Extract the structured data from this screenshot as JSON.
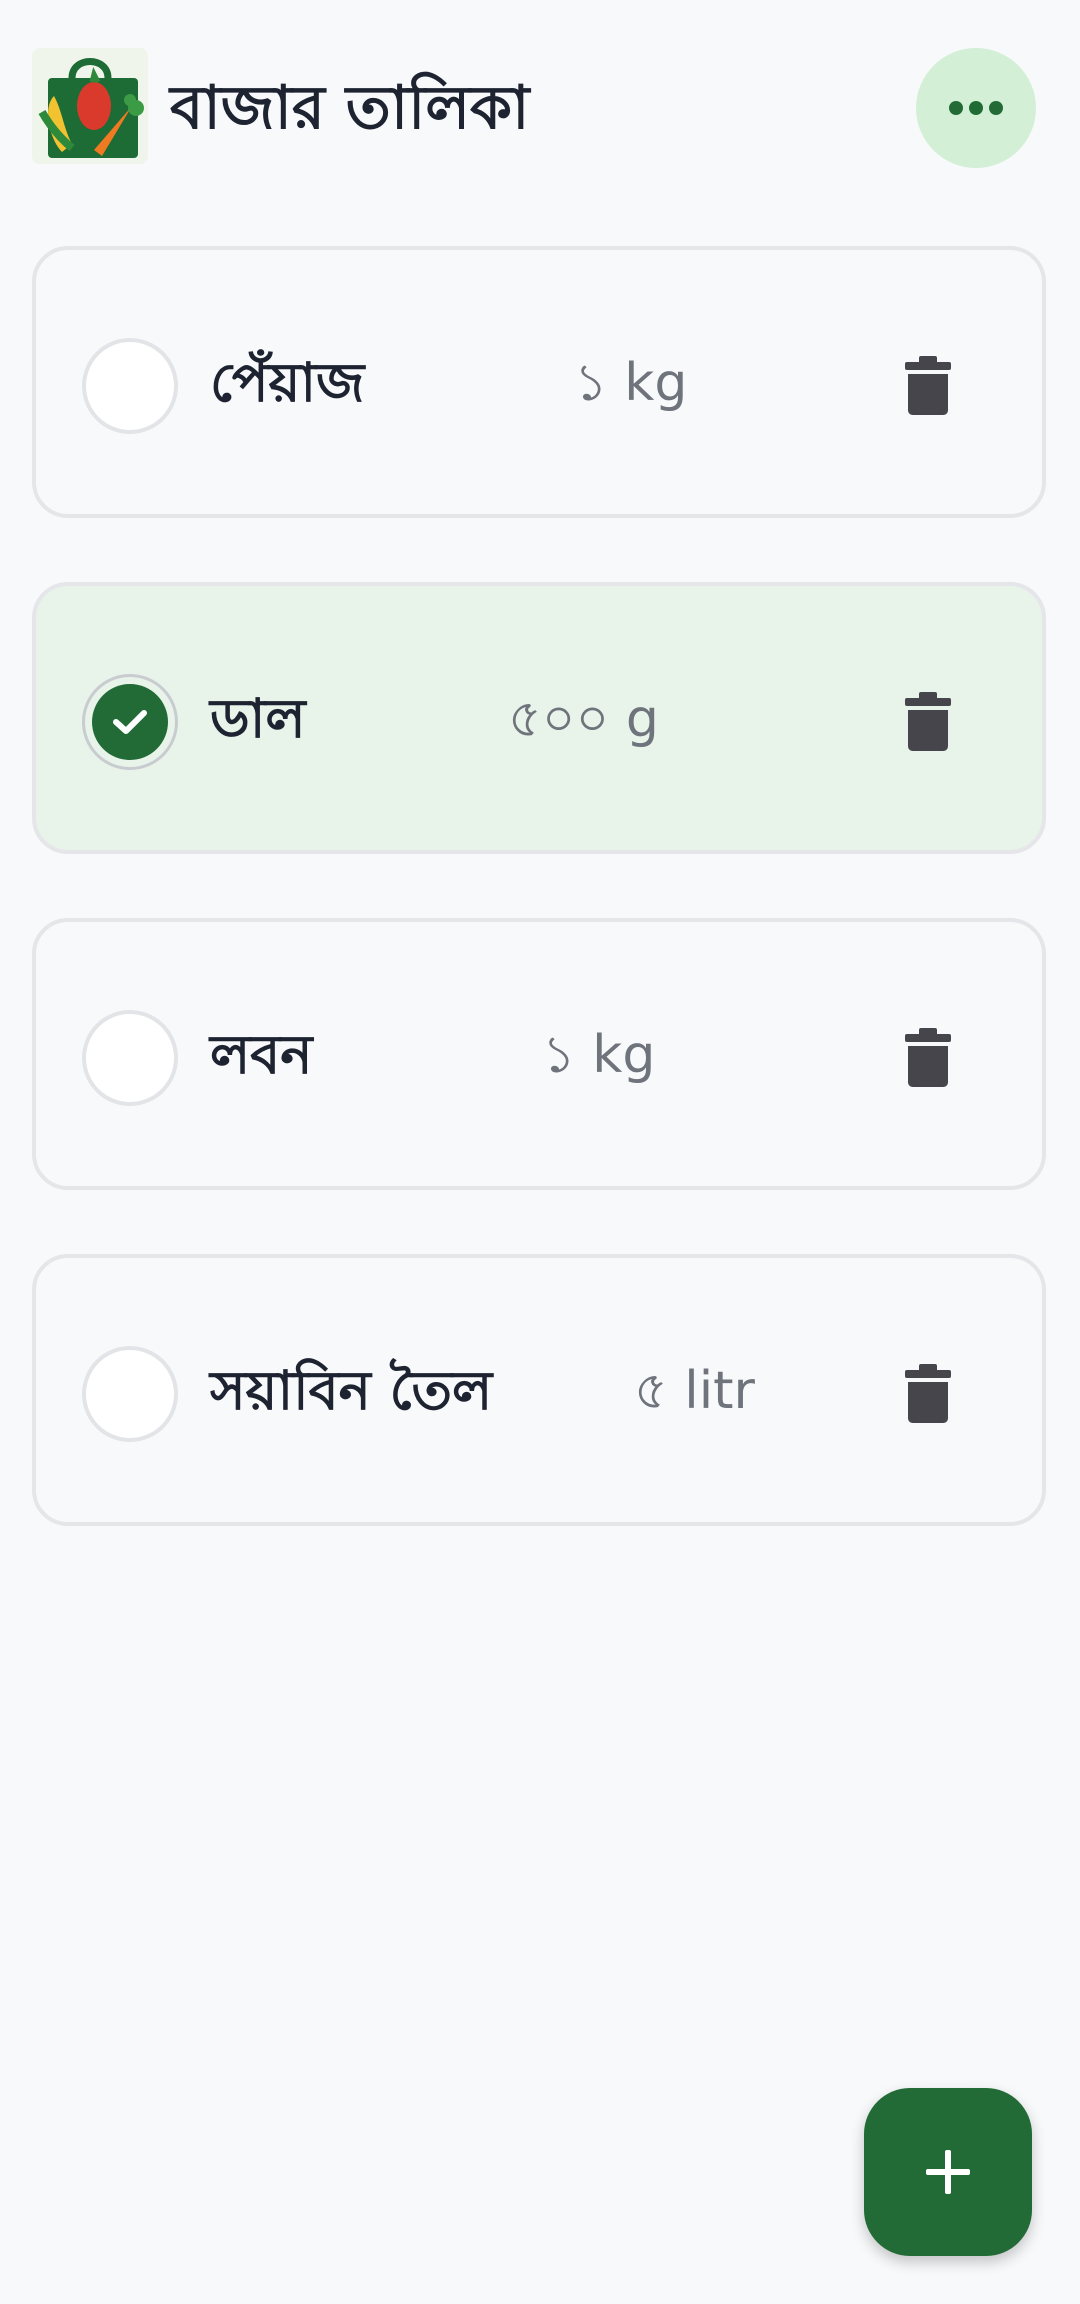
{
  "app": {
    "title": "বাজার তালিকা",
    "logo_icon": "grocery-bag-logo-icon",
    "more_icon": "more-horizontal-icon"
  },
  "colors": {
    "accent": "#226b37",
    "accent_light": "#d3efd6",
    "checked_card_bg": "#e8f3e9",
    "delete_icon": "#46454b"
  },
  "items": [
    {
      "name": "পেঁয়াজ",
      "quantity": "১ kg",
      "checked": false
    },
    {
      "name": "ডাল",
      "quantity": "৫০০ g",
      "checked": true
    },
    {
      "name": "লবন",
      "quantity": "১ kg",
      "checked": false
    },
    {
      "name": "সয়াবিন তৈল",
      "quantity": "৫ litr",
      "checked": false
    }
  ],
  "fab": {
    "icon": "plus-icon"
  }
}
